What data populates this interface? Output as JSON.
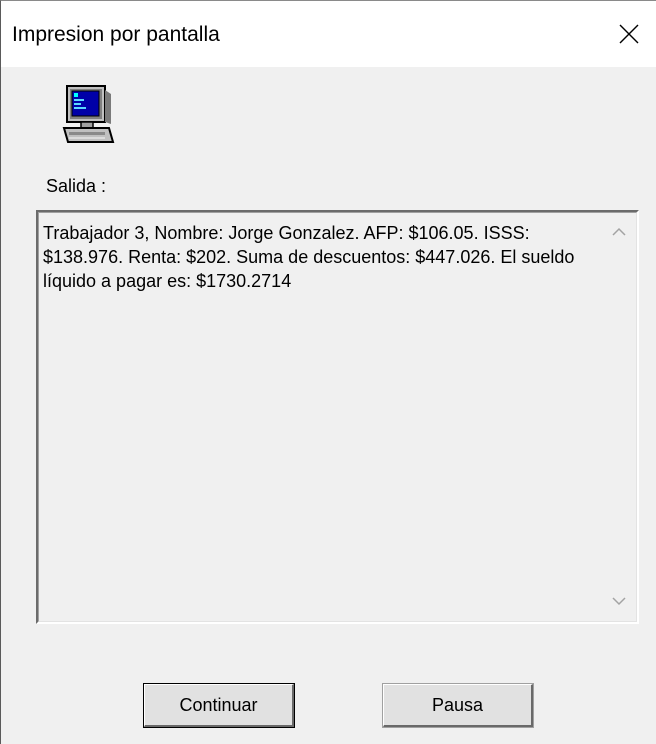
{
  "window": {
    "title": "Impresion por pantalla",
    "close_icon": "close-icon"
  },
  "body": {
    "icon": "computer-monitor-icon",
    "output_label": "Salida :",
    "output_text": "Trabajador 3, Nombre: Jorge Gonzalez. AFP: $106.05. ISSS: $138.976. Renta: $202. Suma de descuentos: $447.026. El sueldo líquido a pagar es: $1730.2714"
  },
  "buttons": {
    "continue_label": "Continuar",
    "pause_label": "Pausa"
  },
  "colors": {
    "dialog_bg": "#f0f0f0",
    "titlebar_bg": "#ffffff",
    "button_bg": "#e1e1e1",
    "monitor_screen": "#0000a8"
  }
}
